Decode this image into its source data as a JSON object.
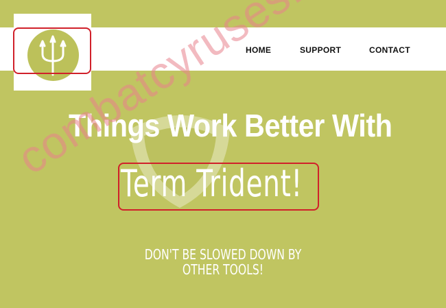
{
  "nav": {
    "items": [
      {
        "label": "HOME"
      },
      {
        "label": "SUPPORT"
      },
      {
        "label": "CONTACT"
      }
    ]
  },
  "hero": {
    "line1": "Things Work Better With",
    "line2": "Term Trident!",
    "tagline": "DON'T BE SLOWED DOWN BY OTHER TOOLS!"
  },
  "watermark": {
    "text": "combatcyruses.com"
  },
  "colors": {
    "background": "#c0c561",
    "logo_green": "#bcc15a",
    "highlight_red": "#d0202a"
  },
  "icons": {
    "logo": "trident-icon",
    "shield": "shield-icon"
  }
}
